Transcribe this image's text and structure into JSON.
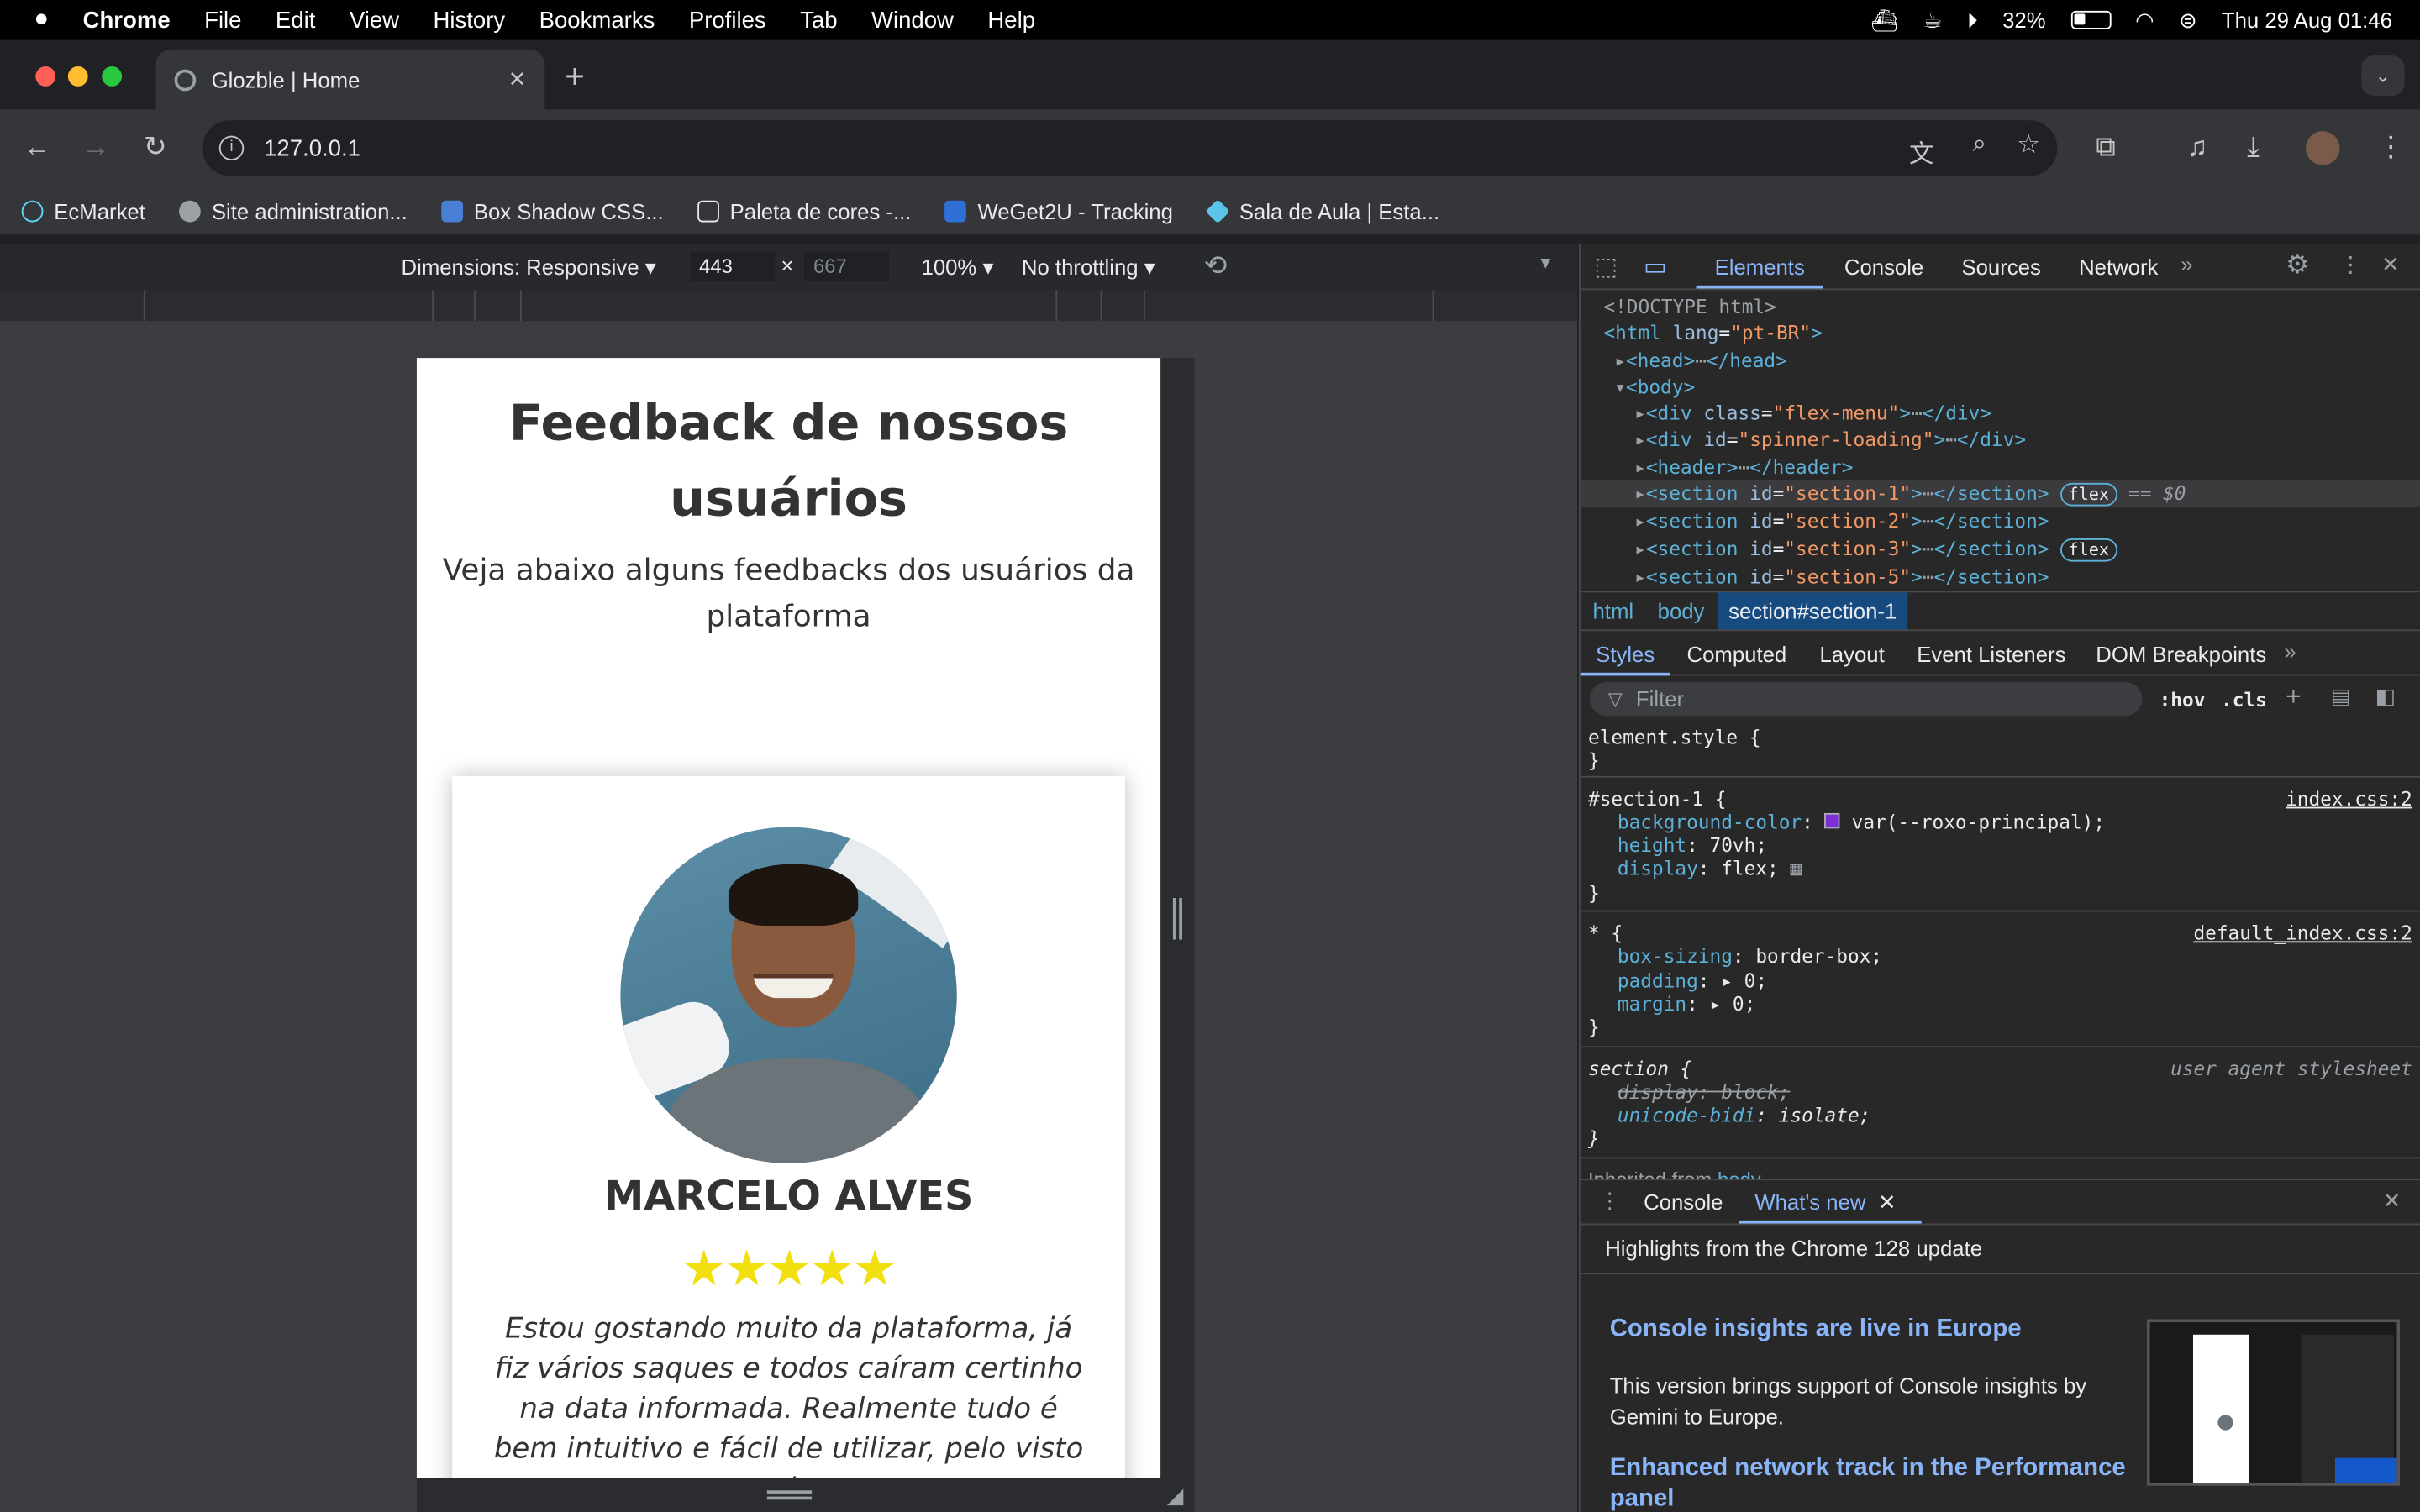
{
  "menubar": {
    "app": "Chrome",
    "items": [
      "File",
      "Edit",
      "View",
      "History",
      "Bookmarks",
      "Profiles",
      "Tab",
      "Window",
      "Help"
    ],
    "battery": "32%",
    "datetime": "Thu 29 Aug  01:46"
  },
  "tab": {
    "title": "Glozble | Home"
  },
  "omnibox": {
    "url": "127.0.0.1"
  },
  "bookmarks": [
    {
      "label": "EcMarket",
      "color": "#61dafb"
    },
    {
      "label": "Site administration...",
      "color": "#9aa0a6"
    },
    {
      "label": "Box Shadow CSS...",
      "color": "#4a7fd6"
    },
    {
      "label": "Paleta de cores -...",
      "color": "#e8eaed"
    },
    {
      "label": "WeGet2U - Tracking",
      "color": "#2f6fd6"
    },
    {
      "label": "Sala de Aula | Esta...",
      "color": "#5cc4e8"
    }
  ],
  "devicebar": {
    "dimensions": "Dimensions: Responsive",
    "width": "443",
    "height": "667",
    "zoom": "100%",
    "throttling": "No throttling"
  },
  "page": {
    "title": "Feedback de nossos usuários",
    "subtitle": "Veja abaixo alguns feedbacks dos usuários da plataforma",
    "card": {
      "name": "MARCELO ALVES",
      "rating": 5,
      "stars": "★★★★★",
      "quote": "Estou gostando muito da plataforma, já fiz vários saques e todos caíram certinho na data informada. Realmente tudo é bem intuitivo e fácil de utilizar, pelo visto todos"
    }
  },
  "devtools": {
    "tabs": [
      "Elements",
      "Console",
      "Sources",
      "Network"
    ],
    "dom": {
      "doctype": "<!DOCTYPE html>",
      "html_lang": "pt-BR",
      "head": "head",
      "body": "body",
      "n1_class": "flex-menu",
      "n2_id": "spinner-loading",
      "n3": "header",
      "n4_id": "section-1",
      "n5_id": "section-2",
      "n6_id": "section-3",
      "n7_id": "section-5",
      "flex_badge": "flex",
      "selected_marker": "== $0"
    },
    "breadcrumb": [
      "html",
      "body",
      "section#section-1"
    ],
    "styles_tabs": [
      "Styles",
      "Computed",
      "Layout",
      "Event Listeners",
      "DOM Breakpoints"
    ],
    "filter_placeholder": "Filter",
    "hov": ":hov",
    "cls": ".cls",
    "rules": {
      "element_style": "element.style {",
      "s1_selector": "#section-1 {",
      "s1_source": "index.css:2",
      "s1_p1_name": "background-color",
      "s1_p1_value": "var(--roxo-principal);",
      "s1_swatch": "#7b2fd4",
      "s1_p2_name": "height",
      "s1_p2_value": "70vh;",
      "s1_p3_name": "display",
      "s1_p3_value": "flex;",
      "s2_selector": "* {",
      "s2_source": "default_index.css:2",
      "s2_p1_name": "box-sizing",
      "s2_p1_value": "border-box;",
      "s2_p2_name": "padding",
      "s2_p2_value": "0;",
      "s2_p3_name": "margin",
      "s2_p3_value": "0;",
      "s3_selector": "section {",
      "s3_source": "user agent stylesheet",
      "s3_p1": "display: block;",
      "s3_p2_name": "unicode-bidi",
      "s3_p2_value": "isolate;",
      "inherited_label": "Inherited from",
      "inherited_from": "body"
    },
    "drawer": {
      "tab_console": "Console",
      "tab_whatsnew": "What's new",
      "highlights": "Highlights from the Chrome 128 update",
      "h1": "Console insights are live in Europe",
      "p1": "This version brings support of Console insights by Gemini to Europe.",
      "h2": "Enhanced network track in the Performance panel"
    }
  }
}
